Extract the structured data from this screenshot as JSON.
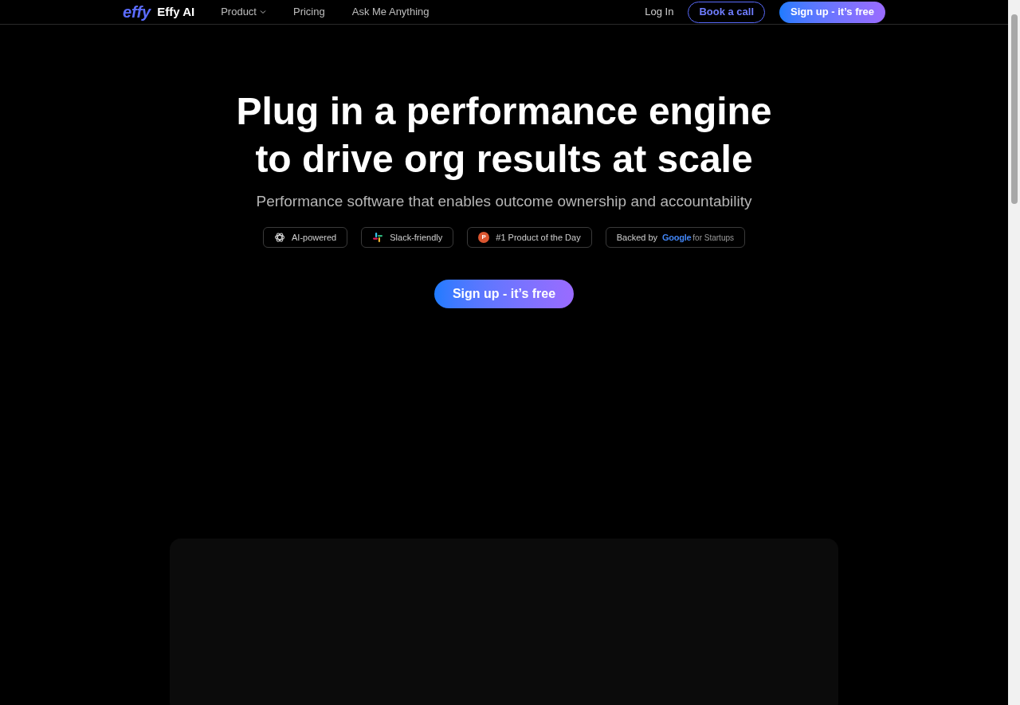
{
  "nav": {
    "logo_mark": "effy",
    "brand": "Effy AI",
    "links": [
      {
        "label": "Product",
        "dropdown": true
      },
      {
        "label": "Pricing",
        "dropdown": false
      },
      {
        "label": "Ask Me Anything",
        "dropdown": false
      }
    ],
    "login": "Log In",
    "book": "Book a call",
    "signup": "Sign up - it’s free"
  },
  "hero": {
    "title_lines": [
      "Plug in a performance engine",
      "to drive org results at scale"
    ],
    "subtitle": "Performance software that enables outcome ownership and accountability",
    "badges": [
      {
        "kind": "ai",
        "label": "AI-powered"
      },
      {
        "kind": "slack",
        "label": "Slack-friendly"
      },
      {
        "kind": "producthunt",
        "glyph": "P",
        "label": "#1 Product of the Day"
      },
      {
        "kind": "google",
        "label": "Backed by",
        "logo": "Google",
        "suffix": "for Startups"
      }
    ],
    "cta": "Sign up - it’s free"
  }
}
